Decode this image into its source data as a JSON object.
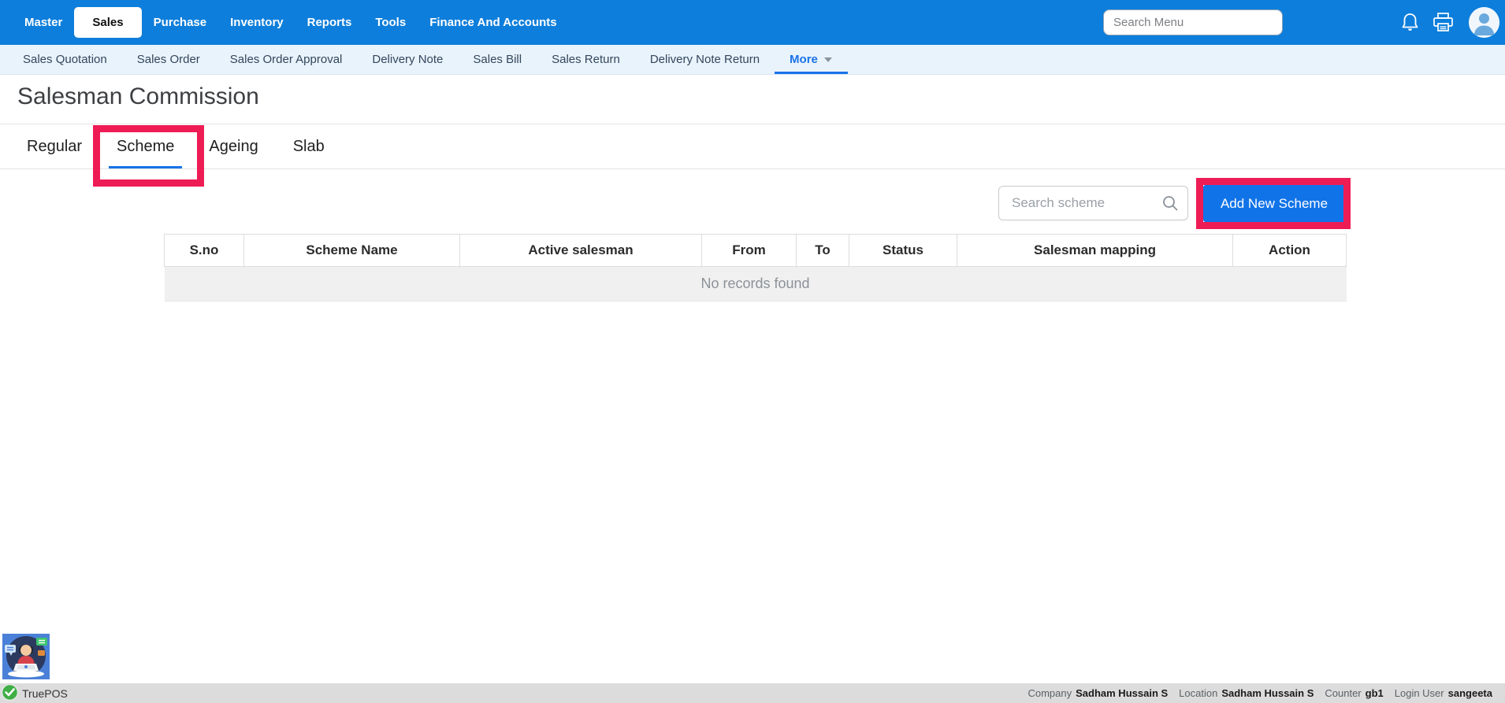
{
  "topnav": {
    "items": [
      "Master",
      "Sales",
      "Purchase",
      "Inventory",
      "Reports",
      "Tools",
      "Finance And Accounts"
    ],
    "active_item": "Sales",
    "search_placeholder": "Search Menu"
  },
  "subnav": {
    "items": [
      "Sales Quotation",
      "Sales Order",
      "Sales Order Approval",
      "Delivery Note",
      "Sales Bill",
      "Sales Return",
      "Delivery Note Return"
    ],
    "more_label": "More",
    "active_item": "More"
  },
  "page": {
    "title": "Salesman Commission"
  },
  "tabs": {
    "items": [
      "Regular",
      "Scheme",
      "Ageing",
      "Slab"
    ],
    "active_item": "Scheme"
  },
  "toolbar": {
    "search_placeholder": "Search scheme",
    "add_button_label": "Add New Scheme"
  },
  "table": {
    "columns": [
      "S.no",
      "Scheme Name",
      "Active salesman",
      "From",
      "To",
      "Status",
      "Salesman mapping",
      "Action"
    ],
    "rows": [],
    "empty_message": "No records found"
  },
  "statusbar": {
    "brand": "TruePOS",
    "fields": [
      {
        "label": "Company",
        "value": "Sadham Hussain S"
      },
      {
        "label": "Location",
        "value": "Sadham Hussain S"
      },
      {
        "label": "Counter",
        "value": "gb1"
      },
      {
        "label": "Login User",
        "value": "sangeeta"
      }
    ]
  },
  "icons": {
    "topbar": [
      "bell-icon",
      "printer-icon",
      "user-avatar-icon"
    ],
    "search": "magnifier-icon",
    "more_caret": "caret-down-icon",
    "brand": "green-check-icon",
    "floating": "support-chat-icon"
  },
  "colors": {
    "topbar_bg": "#0d7edb",
    "subnav_bg": "#e9f3fc",
    "accent_blue": "#1a73e8",
    "button_blue": "#1173e8",
    "highlight_red": "#ee1c55",
    "statusbar_bg": "#dcdcdc",
    "empty_row_bg": "#f0f0f0"
  }
}
